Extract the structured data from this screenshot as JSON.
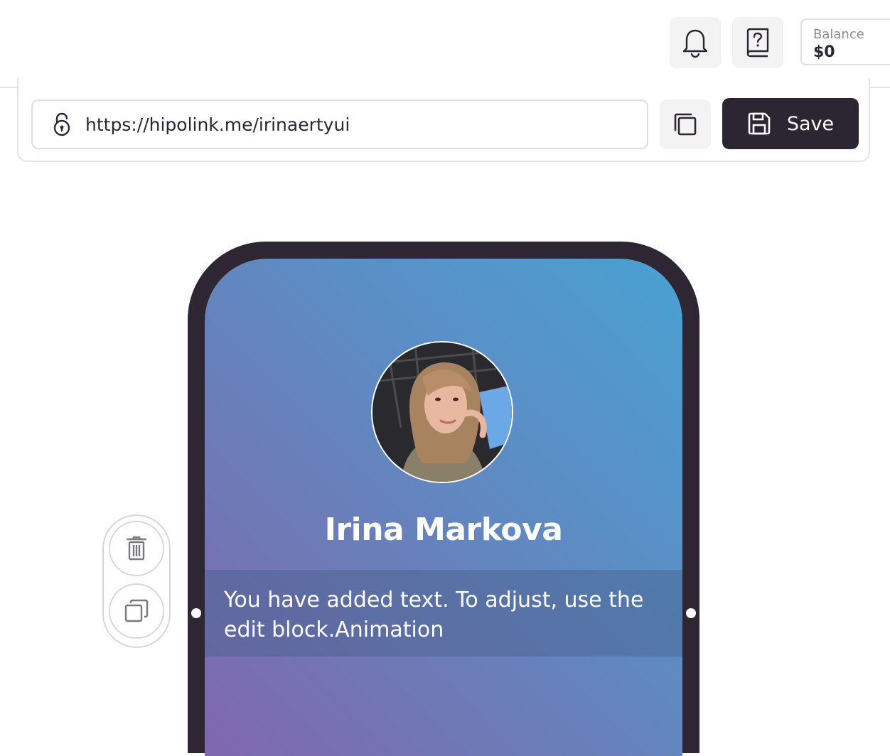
{
  "header": {
    "notifications_icon": "bell-icon",
    "help_icon": "help-book-icon",
    "balance_label": "Balance",
    "balance_value": "$0"
  },
  "link_bar": {
    "url": "https://hipolink.me/irinaertyui",
    "lock_icon": "lock-icon",
    "copy_icon": "copy-icon",
    "save_label": "Save",
    "save_icon": "floppy-disk-icon"
  },
  "preview": {
    "profile_name": "Irina Markova",
    "text_block": "You have added text. To adjust, use the edit block.Animation",
    "gradient_colors": [
      "#4aa1d2",
      "#5a8fc6",
      "#6c7cb8",
      "#8067ad"
    ]
  },
  "block_tools": {
    "delete_icon": "trash-icon",
    "duplicate_icon": "duplicate-icon"
  },
  "colors": {
    "dark": "#2b2631",
    "light_button": "#f3f3f4",
    "border": "#e3e3e6"
  }
}
